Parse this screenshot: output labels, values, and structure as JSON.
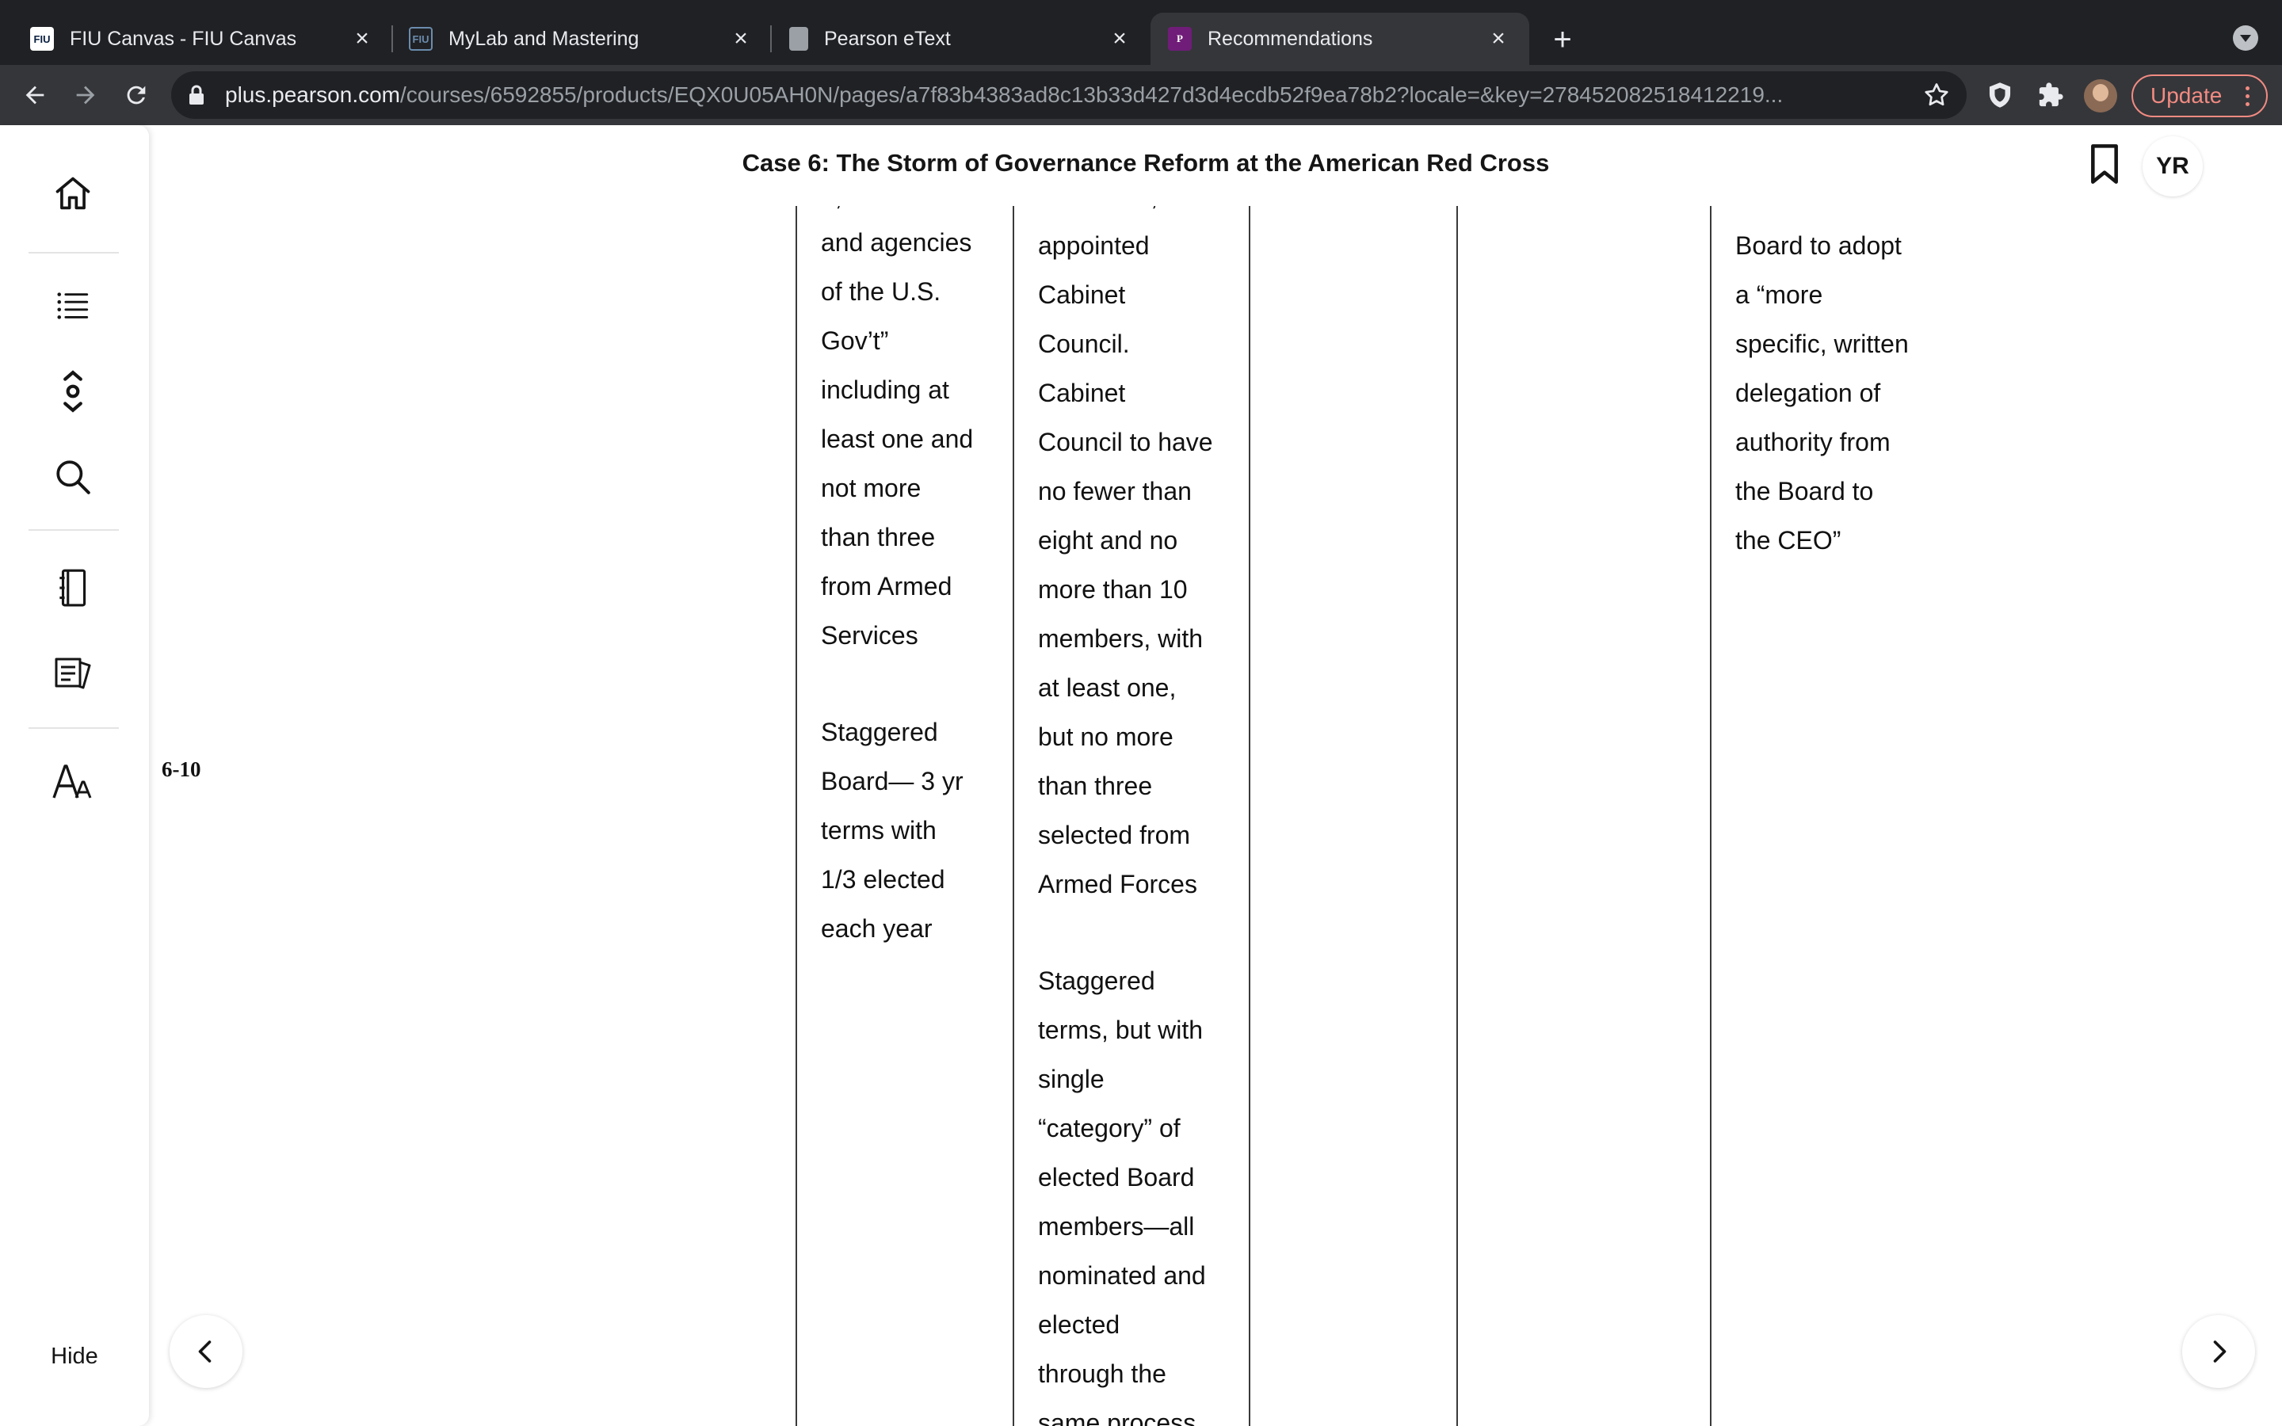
{
  "browser": {
    "tabs": [
      {
        "title": "FIU Canvas - FIU Canvas",
        "favicon": "fiu-icon",
        "favicon_text": "FIU"
      },
      {
        "title": "MyLab and Mastering",
        "favicon": "fiu-mylab-icon",
        "favicon_text": "FIU"
      },
      {
        "title": "Pearson eText",
        "favicon": "book-icon"
      },
      {
        "title": "Recommendations",
        "favicon": "pearson-icon",
        "favicon_text": "P",
        "active": true
      }
    ],
    "url_host": "plus.pearson.com",
    "url_path": "/courses/6592855/products/EQX0U05AH0N/pages/a7f83b4383ad8c13b33d427d3d4ecdb52f9ea78b2?locale=&key=278452082518412219...",
    "update_label": "Update"
  },
  "app": {
    "title": "Case 6: The Storm of Governance Reform at the American Red Cross",
    "avatar_initials": "YR",
    "sidebar": {
      "icons": [
        "home-icon",
        "table-of-contents-icon",
        "navigate-icon",
        "search-icon",
        "notebook-icon",
        "flashcards-icon",
        "text-settings-icon"
      ],
      "hide_label": "Hide"
    },
    "page_number": "6-10",
    "columns": {
      "col2": {
        "paragraph1": [
          "and agencies",
          "of the U.S.",
          "Gov’t”",
          "including at",
          "least one and",
          "not more",
          "than three",
          "from Armed",
          "Services"
        ],
        "paragraph2": [
          "Staggered",
          "Board— 3 yr",
          "terms with",
          "1/3 elected",
          "each year"
        ]
      },
      "col3": {
        "paragraph1": [
          "appointed",
          "Cabinet",
          "Council.",
          "Cabinet",
          "Council to have",
          "no fewer than",
          "eight and no",
          "more than 10",
          "members, with",
          "at least one,",
          "but no more",
          "than three",
          "selected from",
          "Armed Forces"
        ],
        "paragraph2": [
          "Staggered",
          "terms, but with",
          "single",
          "“category” of",
          "elected Board",
          "members—all",
          "nominated and",
          "elected",
          "through the",
          "same process"
        ]
      },
      "col6": {
        "paragraph1": [
          "Board to adopt",
          "a “more",
          "specific, written",
          "delegation of",
          "authority from",
          "the Board to",
          "the CEO”"
        ]
      }
    }
  },
  "colors": {
    "accent": "#6f1d78",
    "update": "#f28b82",
    "chrome_dark": "#202124",
    "chrome_toolbar": "#35363a"
  }
}
